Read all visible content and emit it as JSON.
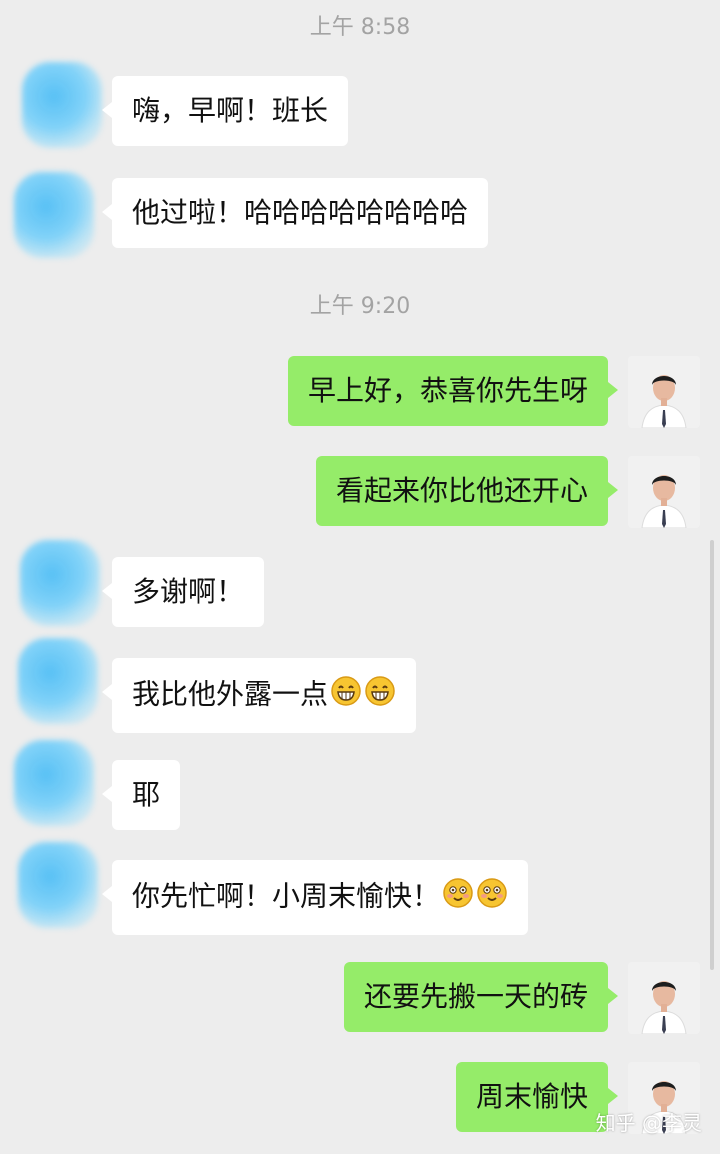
{
  "chat": {
    "timestamps": [
      "上午 8:58",
      "上午 9:20"
    ],
    "messages": [
      {
        "side": "in",
        "text": "嗨，早啊！班长"
      },
      {
        "side": "in",
        "text": "他过啦！哈哈哈哈哈哈哈哈"
      },
      {
        "side": "out",
        "text": "早上好，恭喜你先生呀"
      },
      {
        "side": "out",
        "text": "看起来你比他还开心"
      },
      {
        "side": "in",
        "text": "多谢啊！"
      },
      {
        "side": "in",
        "text": "我比他外露一点"
      },
      {
        "side": "in",
        "text": "耶"
      },
      {
        "side": "in",
        "text": "你先忙啊！小周末愉快！"
      },
      {
        "side": "out",
        "text": "还要先搬一天的砖"
      },
      {
        "side": "out",
        "text": "周末愉快"
      }
    ],
    "emojis": {
      "message_6": [
        "grinning-emoji",
        "grinning-emoji"
      ],
      "message_8": [
        "blushing-emoji",
        "blushing-emoji"
      ]
    }
  },
  "watermark": "知乎 @李灵",
  "colors": {
    "background": "#ededed",
    "incoming_bubble": "#ffffff",
    "outgoing_bubble": "#95ec69",
    "timestamp_text": "#a3a3a3"
  }
}
